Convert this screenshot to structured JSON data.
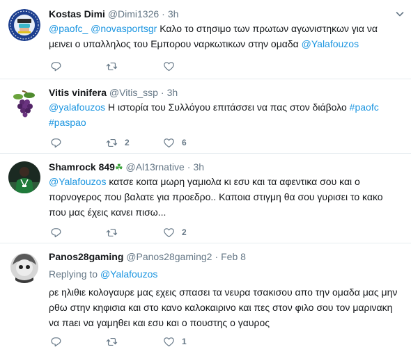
{
  "tweets": [
    {
      "name": "Kostas Dimi",
      "handle": "@Dimi1326",
      "time": "3h",
      "mentions": [
        "@paofc_",
        "@novasportsgr"
      ],
      "text": "Καλο το στησιμο των πρωτων αγωνιστηκων για να μεινει ο υπαλληλος του Εμπορου ναρκωτικων στην ομαδα",
      "tail_mention": "@Yalafouzos",
      "counts": {
        "reply": "",
        "retweet": "",
        "like": ""
      }
    },
    {
      "name": "Vitis vinifera",
      "handle": "@Vitis_ssp",
      "time": "3h",
      "mention": "@yalafouzos",
      "text": "Η ιστορία του Συλλόγου επιτάσσει να πας στον διάβολο",
      "hashtags": [
        "#paofc",
        "#paspao"
      ],
      "counts": {
        "reply": "",
        "retweet": "2",
        "like": "6"
      }
    },
    {
      "name": "Shamrock 849",
      "name_emoji": "☘",
      "handle": "@Al13rnative",
      "time": "3h",
      "mention": "@Yalafouzos",
      "text": "κατσε κοιτα μωρη γαμιολα κι εσυ και τα αφεντικα σου και ο πορνογερος που βαλατε για προεδρο.. Καποια στιγμη θα σου γυρισει το κακο που μας έχεις κανει πισω...",
      "counts": {
        "reply": "",
        "retweet": "",
        "like": "2"
      }
    },
    {
      "name": "Panos28gaming",
      "handle": "@Panos28gaming2",
      "time": "Feb 8",
      "replying_label": "Replying to",
      "replying_to": "@Yalafouzos",
      "text": "ρε ηλιθιε κολογαυρε μας εχεις σπασει τα νευρα τσακισου απο την ομαδα μας μην ρθω στην κηφισια και στο κανο καλοκαιρινο και πες στον φιλο σου τον μαρινακη να πaει να γαμηθει και εσυ και ο πουστης ο γαυρος",
      "counts": {
        "reply": "",
        "retweet": "",
        "like": "1"
      }
    }
  ],
  "colors": {
    "link": "#1b95e0",
    "muted": "#657786",
    "border": "#e6ecf0"
  },
  "icons": [
    "reply-icon",
    "retweet-icon",
    "like-icon",
    "chevron-down-icon",
    "shamrock-emoji"
  ]
}
